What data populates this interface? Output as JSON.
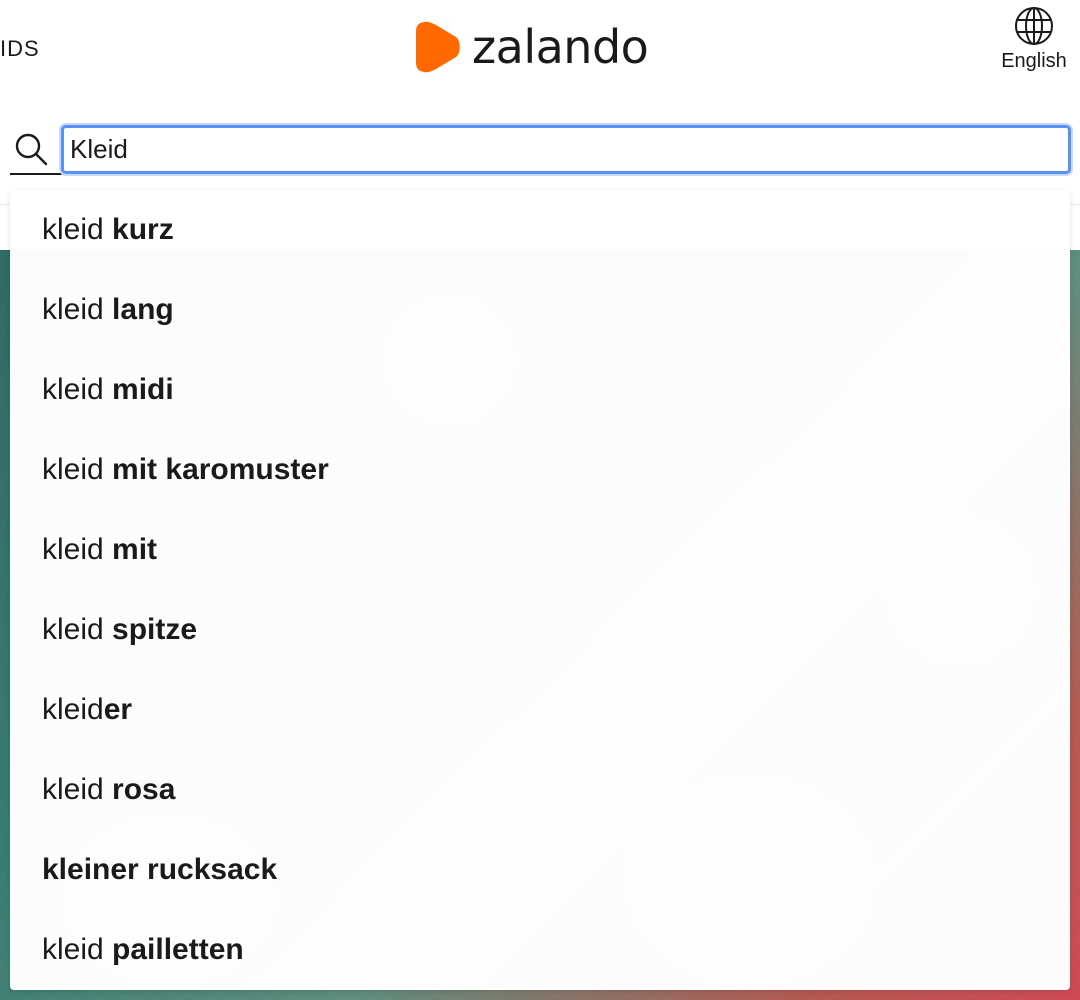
{
  "header": {
    "nav_partial_text": "IDS",
    "logo_text": "zalando",
    "language_label": "English"
  },
  "search": {
    "value": "Kleid"
  },
  "suggestions": [
    {
      "prefix": "kleid ",
      "completion": "kurz"
    },
    {
      "prefix": "kleid ",
      "completion": "lang"
    },
    {
      "prefix": "kleid ",
      "completion": "midi"
    },
    {
      "prefix": "kleid ",
      "completion": "mit karomuster"
    },
    {
      "prefix": "kleid ",
      "completion": "mit"
    },
    {
      "prefix": "kleid ",
      "completion": "spitze"
    },
    {
      "prefix": "kleid",
      "completion": "er"
    },
    {
      "prefix": "kleid ",
      "completion": "rosa"
    },
    {
      "prefix": "",
      "completion": "kleiner rucksack"
    },
    {
      "prefix": "kleid ",
      "completion": "pailletten"
    }
  ],
  "icons": {
    "logo": "zalando-logo-mark",
    "language": "globe-icon",
    "search": "search-icon"
  },
  "colors": {
    "brand_orange": "#ff6900",
    "focus_blue": "#5b91f5",
    "text": "#1a1a1a"
  }
}
